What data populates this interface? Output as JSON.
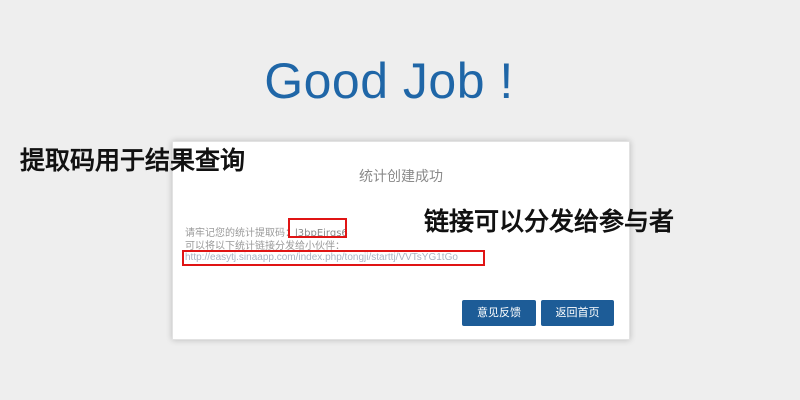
{
  "headline": "Good Job !",
  "dialog": {
    "title": "统计创建成功",
    "code_prefix": "请牢记您的统计提取码：",
    "code_value": "l3bpEirqs6",
    "share_text": "可以将以下统计链接分发给小伙伴：",
    "link": "http://easytj.sinaapp.com/index.php/tongji/starttj/VVTsYG1tGo",
    "feedback_label": "意见反馈",
    "home_label": "返回首页"
  },
  "annotations": {
    "code_note": "提取码用于结果查询",
    "link_note": "链接可以分发给参与者"
  },
  "colors": {
    "background": "#eeeeee",
    "headline": "#1f66a7",
    "button": "#1d5c97",
    "highlight_box": "#e01414"
  }
}
